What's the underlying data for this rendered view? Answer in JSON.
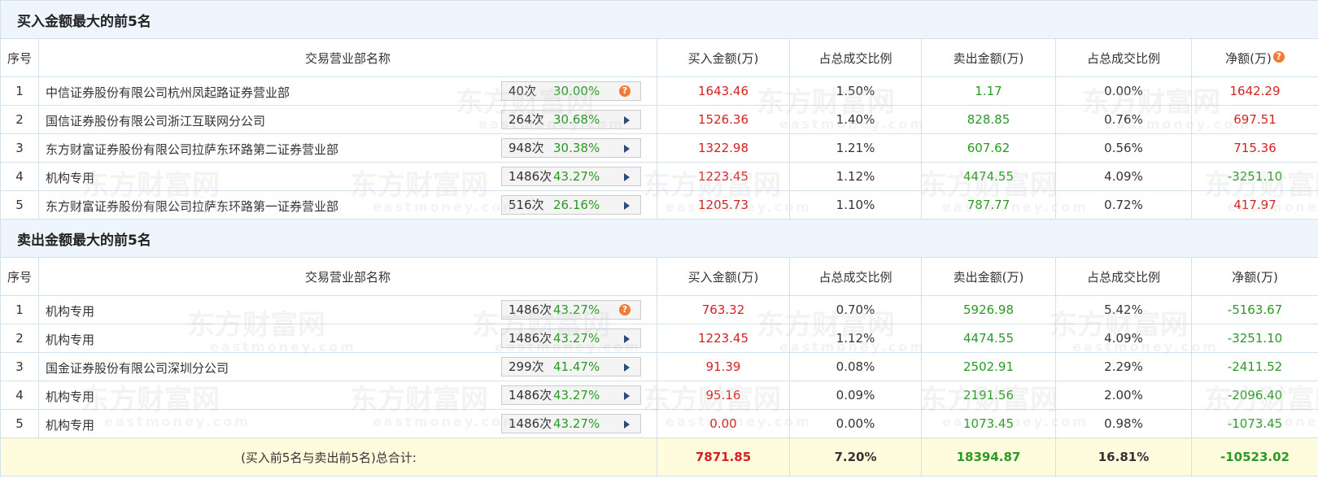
{
  "buy_section": {
    "title": "买入金额最大的前5名",
    "headers": [
      "序号",
      "交易营业部名称",
      "买入金额(万)",
      "占总成交比例",
      "卖出金额(万)",
      "占总成交比例",
      "净额(万)"
    ],
    "rows": [
      {
        "idx": "1",
        "name": "中信证券股份有限公司杭州凤起路证券营业部",
        "count": "40次",
        "pct": "30.00%",
        "buy": "1643.46",
        "buy_ratio": "1.50%",
        "sell": "1.17",
        "sell_ratio": "0.00%",
        "net": "1642.29"
      },
      {
        "idx": "2",
        "name": "国信证券股份有限公司浙江互联网分公司",
        "count": "264次",
        "pct": "30.68%",
        "buy": "1526.36",
        "buy_ratio": "1.40%",
        "sell": "828.85",
        "sell_ratio": "0.76%",
        "net": "697.51"
      },
      {
        "idx": "3",
        "name": "东方财富证券股份有限公司拉萨东环路第二证券营业部",
        "count": "948次",
        "pct": "30.38%",
        "buy": "1322.98",
        "buy_ratio": "1.21%",
        "sell": "607.62",
        "sell_ratio": "0.56%",
        "net": "715.36"
      },
      {
        "idx": "4",
        "name": "机构专用",
        "count": "1486次",
        "pct": "43.27%",
        "buy": "1223.45",
        "buy_ratio": "1.12%",
        "sell": "4474.55",
        "sell_ratio": "4.09%",
        "net": "-3251.10"
      },
      {
        "idx": "5",
        "name": "东方财富证券股份有限公司拉萨东环路第一证券营业部",
        "count": "516次",
        "pct": "26.16%",
        "buy": "1205.73",
        "buy_ratio": "1.10%",
        "sell": "787.77",
        "sell_ratio": "0.72%",
        "net": "417.97"
      }
    ]
  },
  "sell_section": {
    "title": "卖出金额最大的前5名",
    "headers": [
      "序号",
      "交易营业部名称",
      "买入金额(万)",
      "占总成交比例",
      "卖出金额(万)",
      "占总成交比例",
      "净额(万)"
    ],
    "rows": [
      {
        "idx": "1",
        "name": "机构专用",
        "count": "1486次",
        "pct": "43.27%",
        "buy": "763.32",
        "buy_ratio": "0.70%",
        "sell": "5926.98",
        "sell_ratio": "5.42%",
        "net": "-5163.67"
      },
      {
        "idx": "2",
        "name": "机构专用",
        "count": "1486次",
        "pct": "43.27%",
        "buy": "1223.45",
        "buy_ratio": "1.12%",
        "sell": "4474.55",
        "sell_ratio": "4.09%",
        "net": "-3251.10"
      },
      {
        "idx": "3",
        "name": "国金证券股份有限公司深圳分公司",
        "count": "299次",
        "pct": "41.47%",
        "buy": "91.39",
        "buy_ratio": "0.08%",
        "sell": "2502.91",
        "sell_ratio": "2.29%",
        "net": "-2411.52"
      },
      {
        "idx": "4",
        "name": "机构专用",
        "count": "1486次",
        "pct": "43.27%",
        "buy": "95.16",
        "buy_ratio": "0.09%",
        "sell": "2191.56",
        "sell_ratio": "2.00%",
        "net": "-2096.40"
      },
      {
        "idx": "5",
        "name": "机构专用",
        "count": "1486次",
        "pct": "43.27%",
        "buy": "0.00",
        "buy_ratio": "0.00%",
        "sell": "1073.45",
        "sell_ratio": "0.98%",
        "net": "-1073.45"
      }
    ]
  },
  "total": {
    "label": "(买入前5名与卖出前5名)总合计:",
    "buy": "7871.85",
    "buy_ratio": "7.20%",
    "sell": "18394.87",
    "sell_ratio": "16.81%",
    "net": "-10523.02"
  },
  "watermark": {
    "main": "东方财富网",
    "sub": "eastmoney.com"
  },
  "icons": {
    "help": "question-icon",
    "expand": "play-triangle-icon"
  },
  "colors": {
    "positive": "#d32222",
    "negative": "#2a9a24",
    "total_bg": "#fffbdc",
    "section_bg": "#eef5fc"
  }
}
